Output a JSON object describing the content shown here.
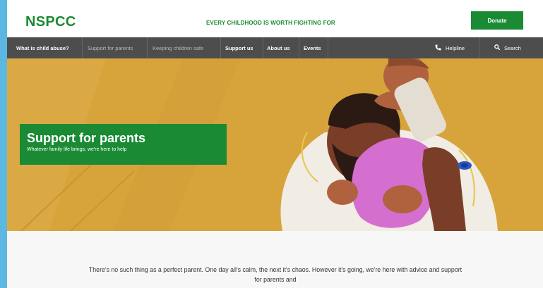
{
  "header": {
    "logo": "NSPCC",
    "tagline": "EVERY CHILDHOOD IS WORTH FIGHTING FOR",
    "donate_label": "Donate"
  },
  "nav": {
    "items": [
      {
        "label": "What is child abuse?"
      },
      {
        "label": "Support for parents"
      },
      {
        "label": "Keeping children safe"
      },
      {
        "label": "Support us"
      },
      {
        "label": "About us"
      },
      {
        "label": "Events"
      }
    ],
    "helpline_label": "Helpline",
    "search_label": "Search"
  },
  "hero": {
    "title": "Support for parents",
    "subtitle": "Whatever family life brings, we're here to help"
  },
  "intro": {
    "text": "There's no such thing as a perfect parent. One day all's calm, the next it's chaos. However it's going, we're here with advice and support for parents and"
  },
  "colors": {
    "brand_green": "#1a8b34",
    "nav_bg": "#4d4d4d",
    "hero_bg": "#d7a43c"
  },
  "icons": {
    "helpline": "phone-icon",
    "search": "search-icon"
  }
}
